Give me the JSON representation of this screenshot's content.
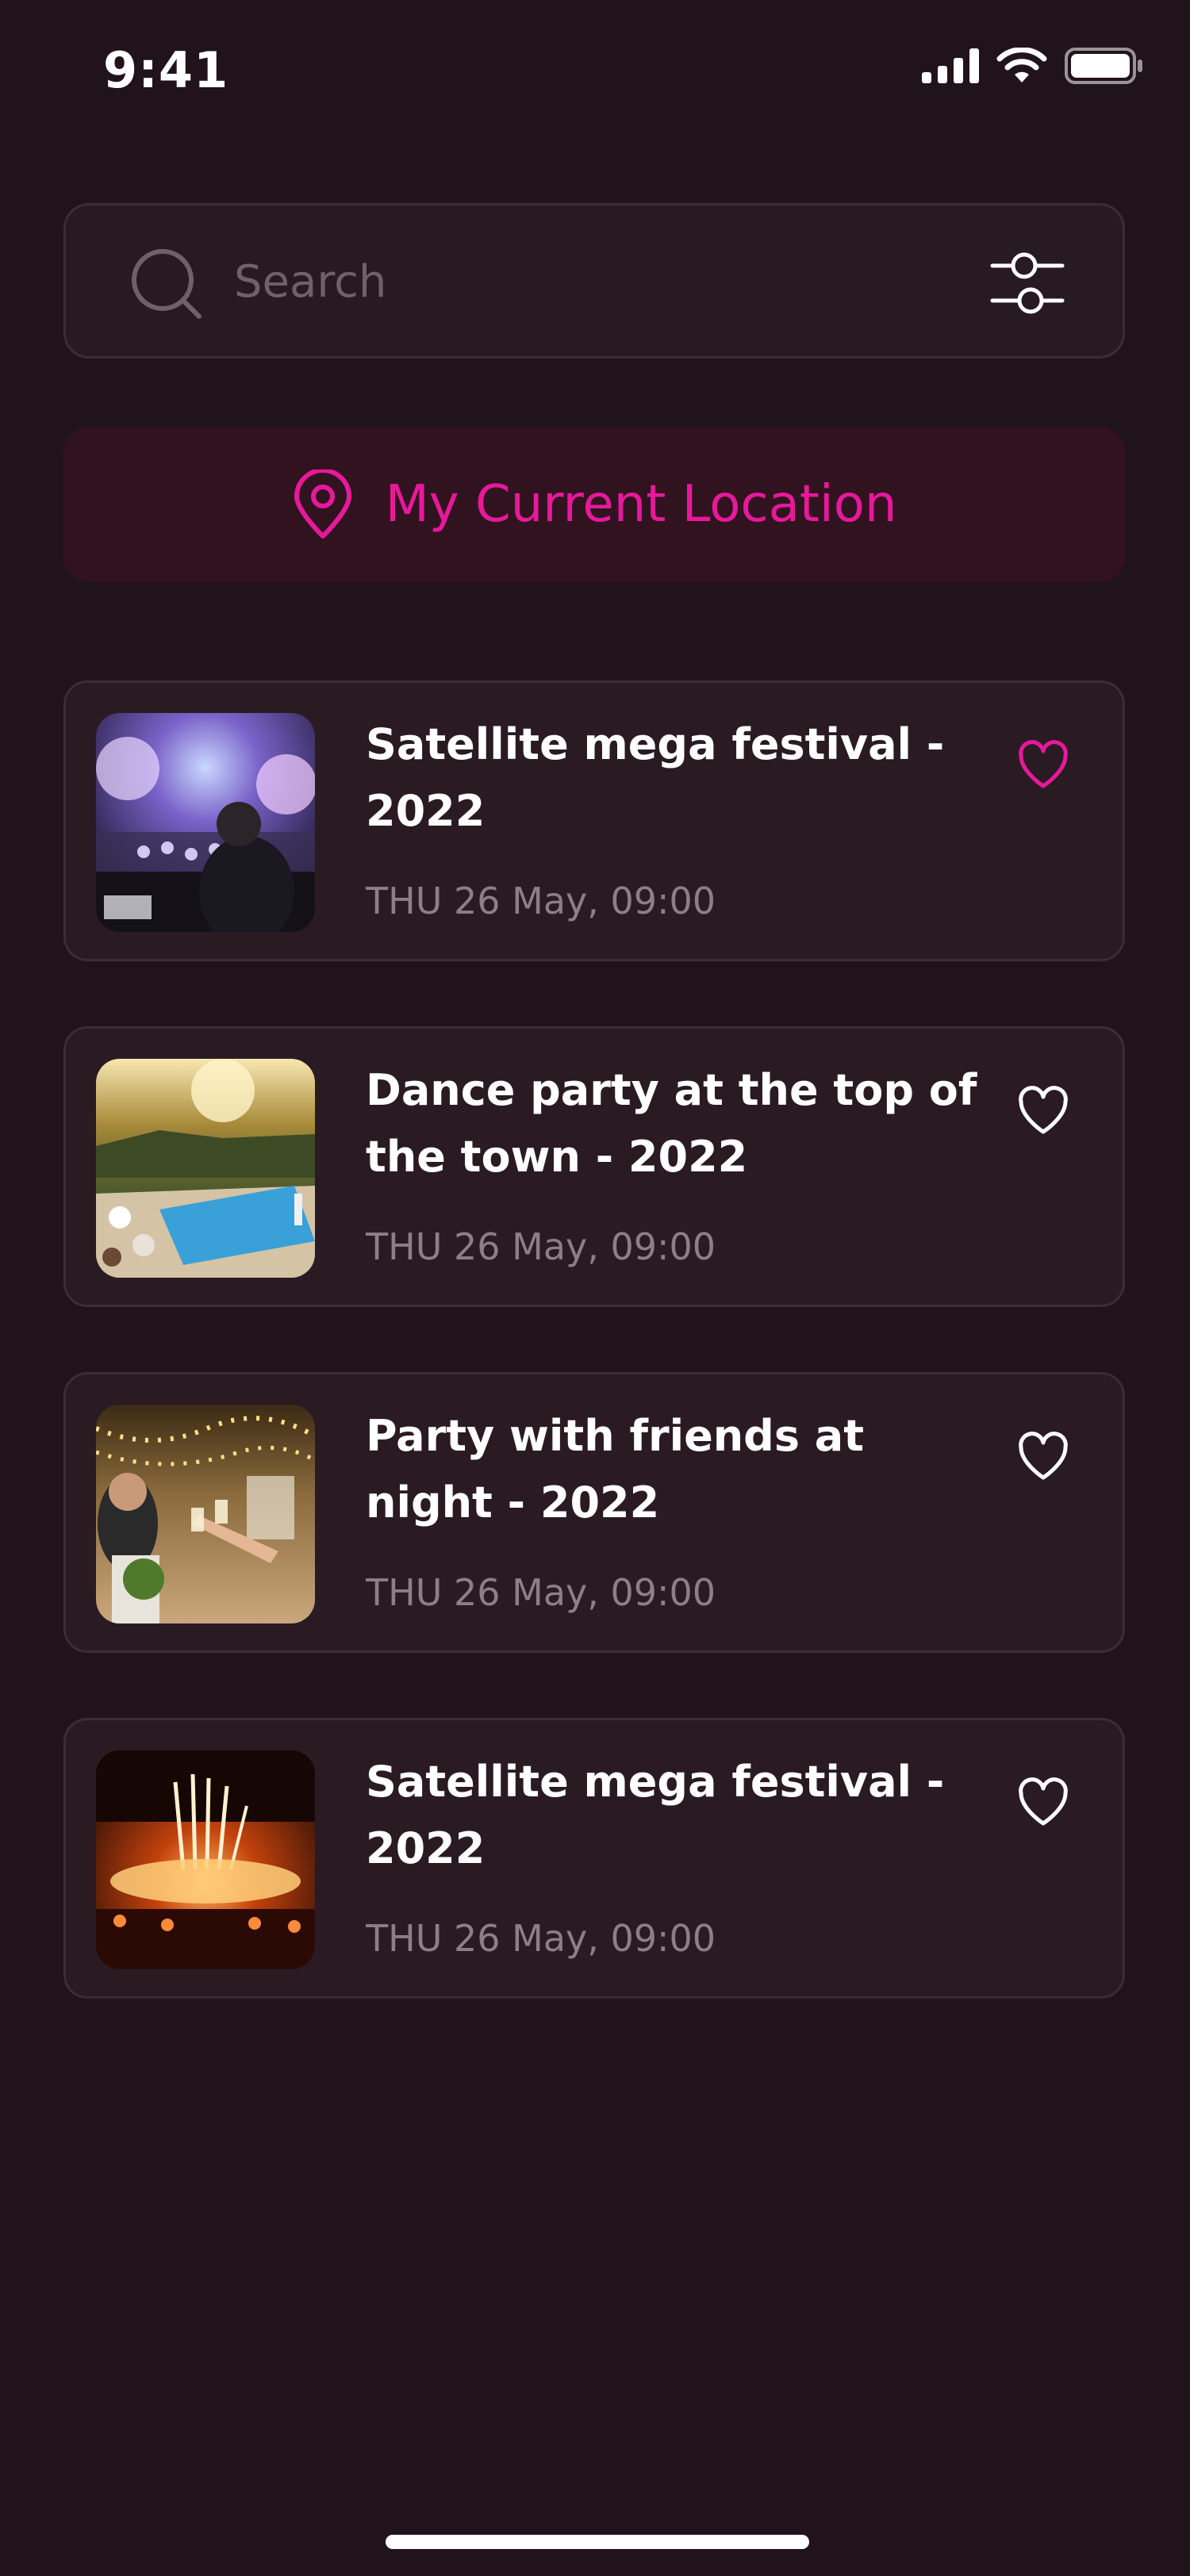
{
  "status_bar": {
    "time": "9:41"
  },
  "search": {
    "placeholder": "Search",
    "value": ""
  },
  "location": {
    "label": "My Current Location",
    "accent_color": "#e8189b"
  },
  "events": [
    {
      "title": "Satellite mega festival - 2022",
      "date": "THU 26 May, 09:00",
      "favorited": true,
      "image": "concert-dj-crowd"
    },
    {
      "title": "Dance party at the top of the town - 2022",
      "date": "THU 26 May, 09:00",
      "favorited": false,
      "image": "pool-party-sunset"
    },
    {
      "title": "Party with friends at night - 2022",
      "date": "THU 26 May, 09:00",
      "favorited": false,
      "image": "friends-toast-lights"
    },
    {
      "title": "Satellite mega festival - 2022",
      "date": "THU 26 May, 09:00",
      "favorited": false,
      "image": "festival-fireworks"
    }
  ],
  "colors": {
    "background": "#21131b",
    "card": "#2a1b23",
    "accent": "#e8189b",
    "muted_text": "#8c7f86"
  }
}
